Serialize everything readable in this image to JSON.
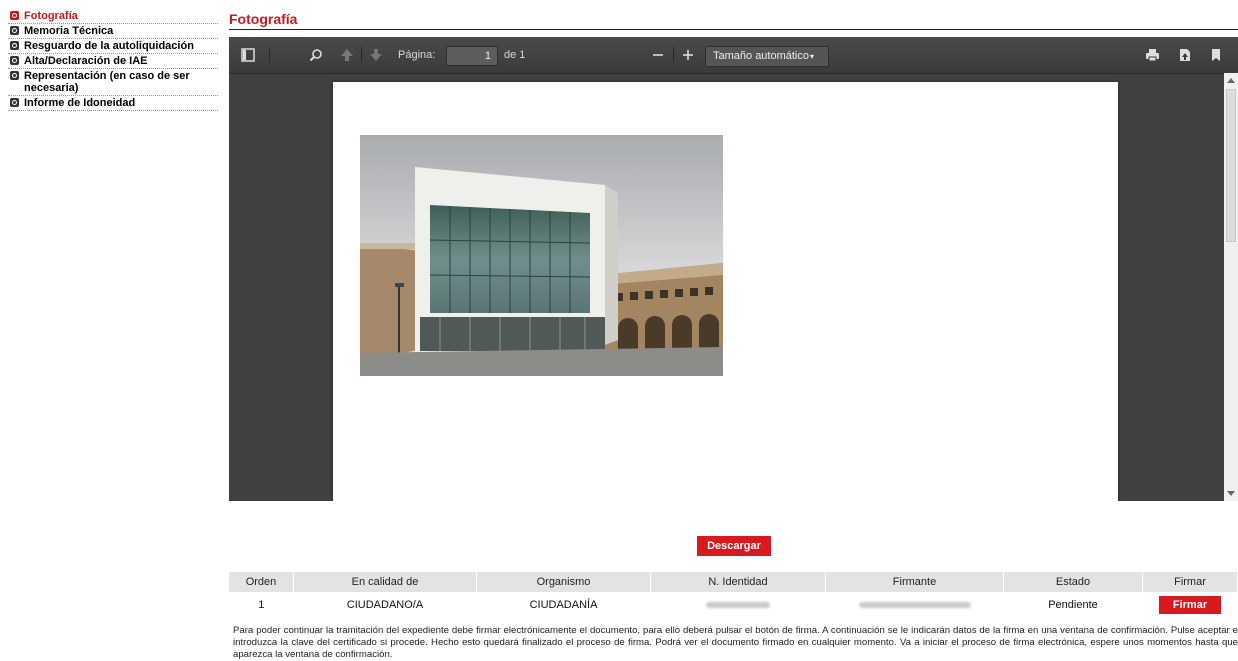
{
  "sidebar": {
    "items": [
      {
        "label": "Fotografía",
        "active": true
      },
      {
        "label": "Memoria Técnica",
        "active": false
      },
      {
        "label": "Resguardo de la autoliquidación",
        "active": false
      },
      {
        "label": "Alta/Declaración de IAE",
        "active": false
      },
      {
        "label": "Representación (en caso de ser necesaria)",
        "active": false
      },
      {
        "label": "Informe de Idoneidad",
        "active": false
      }
    ]
  },
  "page_title": "Fotografía",
  "viewer": {
    "page_label": "Página:",
    "page_value": "1",
    "page_total": "de 1",
    "zoom_value": "Tamaño automático",
    "icons": [
      "sidebar-toggle-icon",
      "search-icon",
      "previous-page-icon",
      "next-page-icon",
      "zoom-out-icon",
      "zoom-in-icon",
      "print-icon",
      "download-icon",
      "bookmark-icon"
    ]
  },
  "download_label": "Descargar",
  "table": {
    "headers": [
      "Orden",
      "En calidad de",
      "Organismo",
      "N. Identidad",
      "Firmante",
      "Estado",
      "Firmar"
    ],
    "row": {
      "orden": "1",
      "calidad": "CIUDADANO/A",
      "organismo": "CIUDADANÍA",
      "estado": "Pendiente",
      "firmar_label": "Firmar"
    }
  },
  "info_text": "Para poder continuar la tramitación del expediente debe firmar electrónicamente el documento, para ello deberá pulsar el botón de firma. A continuación se le indicarán datos de la firma en una ventana de confirmación. Pulse aceptar e introduzca la clave del certificado si procede. Hecho esto quedará finalizado el proceso de firma. Podrá ver el documento firmado en cualquier momento. Va a iniciar el proceso de firma electrónica, espere unos momentos hasta que aparezca la ventana de confirmación.",
  "colors": {
    "accent": "#d8191f",
    "viewer_bg": "#404040",
    "toolbar": "#474747"
  }
}
